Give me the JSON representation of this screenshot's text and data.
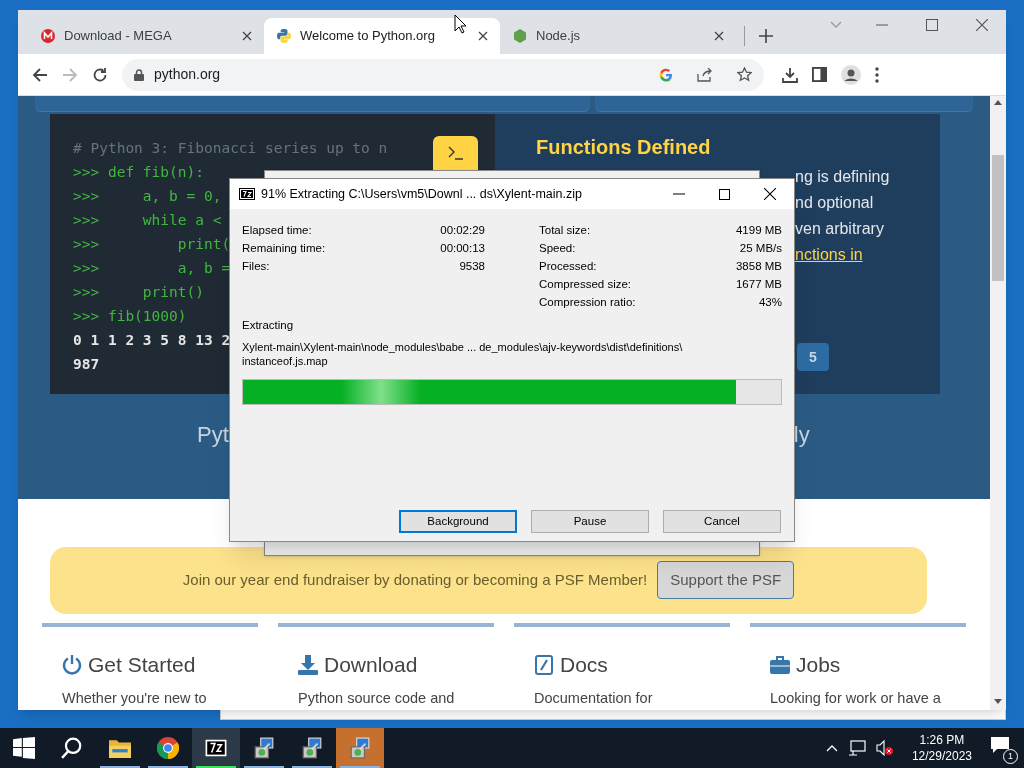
{
  "browser": {
    "tabs": [
      {
        "title": "Download - MEGA",
        "selected": false
      },
      {
        "title": "Welcome to Python.org",
        "selected": true
      },
      {
        "title": "Node.js",
        "selected": false
      }
    ],
    "back_enabled": true,
    "forward_enabled": false,
    "url": "python.org"
  },
  "page": {
    "code_lines": [
      {
        "kind": "comment",
        "text": "# Python 3: Fibonacci series up to n"
      },
      {
        "kind": "input",
        "text": ">>> def fib(n):"
      },
      {
        "kind": "input",
        "text": ">>>     a, b = 0,"
      },
      {
        "kind": "input",
        "text": ">>>     while a <"
      },
      {
        "kind": "input",
        "text": ">>>         print("
      },
      {
        "kind": "input",
        "text": ">>>         a, b ="
      },
      {
        "kind": "input",
        "text": ">>>     print()"
      },
      {
        "kind": "input",
        "text": ">>> fib(1000)"
      },
      {
        "kind": "output",
        "text": "0 1 1 2 3 5 8 13 2"
      },
      {
        "kind": "output",
        "text": "987"
      }
    ],
    "feature_heading": "Functions Defined",
    "feature_lines": [
      {
        "kind": "text",
        "text": "ng is defining"
      },
      {
        "kind": "text",
        "text": "nd optional"
      },
      {
        "kind": "text",
        "text": "ven arbitrary"
      },
      {
        "kind": "link",
        "text": "nctions in"
      }
    ],
    "pager_button": "5",
    "tagline_left": "Pyt",
    "tagline_right": "ly",
    "banner": {
      "text": "Join our year end fundraiser by donating or becoming a PSF Member!",
      "button": "Support the PSF"
    },
    "columns": [
      {
        "title": "Get Started",
        "text": "Whether you're new to"
      },
      {
        "title": "Download",
        "text": "Python source code and"
      },
      {
        "title": "Docs",
        "text": "Documentation for"
      },
      {
        "title": "Jobs",
        "text": "Looking for work or have a"
      }
    ]
  },
  "dialog": {
    "title": "91% Extracting C:\\Users\\vm5\\Downl ... ds\\Xylent-main.zip",
    "stats_left": [
      {
        "label": "Elapsed time:",
        "value": "00:02:29"
      },
      {
        "label": "Remaining time:",
        "value": "00:00:13"
      },
      {
        "label": "Files:",
        "value": "9538"
      }
    ],
    "stats_right": [
      {
        "label": "Total size:",
        "value": "4199 MB"
      },
      {
        "label": "Speed:",
        "value": "25 MB/s"
      },
      {
        "label": "Processed:",
        "value": "3858 MB"
      },
      {
        "label": "Compressed size:",
        "value": "1677 MB"
      },
      {
        "label": "Compression ratio:",
        "value": "43%"
      }
    ],
    "section": "Extracting",
    "path": "Xylent-main\\Xylent-main\\node_modules\\babe ... de_modules\\ajv-keywords\\dist\\definitions\\ instanceof.js.map",
    "progress": {
      "level": 0.917
    },
    "buttons": [
      {
        "label": "Background",
        "default": true
      },
      {
        "label": "Pause",
        "default": false
      },
      {
        "label": "Cancel",
        "default": false
      }
    ]
  },
  "taskbar": {
    "apps": [
      {
        "kind": "start",
        "selected": false,
        "running": false,
        "attention": false
      },
      {
        "kind": "search",
        "selected": false,
        "running": false,
        "attention": false
      },
      {
        "kind": "folder",
        "selected": false,
        "running": true,
        "attention": false
      },
      {
        "kind": "chrome",
        "selected": false,
        "running": true,
        "attention": false
      },
      {
        "kind": "archiver",
        "selected": true,
        "running": true,
        "attention": false
      },
      {
        "kind": "installer",
        "selected": false,
        "running": true,
        "attention": false
      },
      {
        "kind": "installer",
        "selected": false,
        "running": true,
        "attention": false
      },
      {
        "kind": "installer",
        "selected": false,
        "running": true,
        "attention": true
      }
    ],
    "time": "1:26 PM",
    "date": "12/29/2023",
    "notifications": "1"
  }
}
